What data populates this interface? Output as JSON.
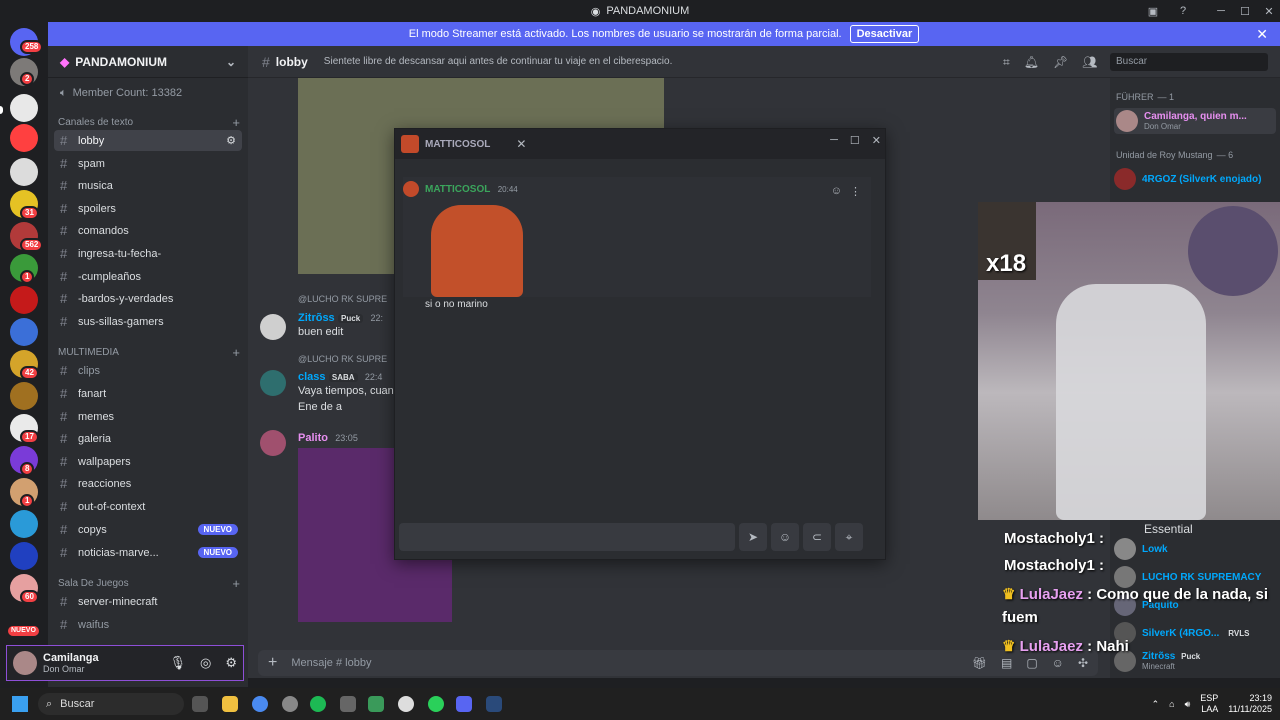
{
  "window": {
    "title": "PANDAMONIUM"
  },
  "banner": {
    "text": "El modo Streamer está activado. Los nombres de usuario se mostrarán de forma parcial.",
    "button": "Desactivar"
  },
  "rail": {
    "badges": [
      "258",
      "2",
      "31",
      "562",
      "1",
      "42",
      "17",
      "8",
      "1",
      "60",
      "NUEVO"
    ]
  },
  "server": {
    "name": "PANDAMONIUM",
    "member_count": "Member Count: 13382"
  },
  "categories": {
    "text": "Canales de texto",
    "media": "MULTIMEDIA",
    "games": "Sala De Juegos"
  },
  "channels": [
    {
      "label": "lobby"
    },
    {
      "label": "spam"
    },
    {
      "label": "musica"
    },
    {
      "label": "spoilers"
    },
    {
      "label": "comandos"
    },
    {
      "label": "ingresa-tu-fecha-"
    },
    {
      "label": "-cumpleaños"
    },
    {
      "label": "-bardos-y-verdades"
    },
    {
      "label": "sus-sillas-gamers"
    },
    {
      "label": "clips"
    },
    {
      "label": "fanart"
    },
    {
      "label": "memes"
    },
    {
      "label": "galeria"
    },
    {
      "label": "wallpapers"
    },
    {
      "label": "reacciones"
    },
    {
      "label": "out-of-context"
    },
    {
      "label": "copys",
      "badge": "NUEVO"
    },
    {
      "label": "noticias-marve...",
      "badge": "NUEVO"
    },
    {
      "label": "server-minecraft"
    },
    {
      "label": "waifus"
    }
  ],
  "user": {
    "name": "Camilanga",
    "status": "Don Omar"
  },
  "chat": {
    "channel": "lobby",
    "topic": "Sientete libre de descansar aqui antes de continuar tu viaje en el ciberespacio.",
    "search_placeholder": "Buscar",
    "composer_placeholder": "Mensaje #",
    "composer_channel": "lobby",
    "messages": [
      {
        "reply": "@LUCHO RK SUPRE",
        "author": "Zitrõss",
        "tag": "Puck",
        "time": "22:",
        "text": "buen edit"
      },
      {
        "reply": "@LUCHO RK SUPRE",
        "author": "class",
        "tag": "SABA",
        "time": "22:4",
        "text": "Vaya tiempos, cuando",
        "text2": "Ene de a"
      },
      {
        "author": "Palito",
        "time": "23:05"
      }
    ]
  },
  "popout": {
    "title": "MATTICOSOL",
    "author": "MATTICOSOL",
    "time": "20:44",
    "text": "si o no marino"
  },
  "members": {
    "role1": "FÜHRER",
    "role1_count": "— 1",
    "m1_name": "Camilanga, quien m...",
    "m1_status": "Don Omar",
    "role2": "Unidad de Roy Mustang",
    "role2_count": "— 6",
    "m2_name": "4RGOZ (SilverK enojado)",
    "m3_status": "Essential",
    "m4_name": "Lowk",
    "m5_name": "LUCHO RK SUPREMACY",
    "m6_name": "Paquito",
    "m7_name": "SilverK (4RGO...",
    "m7_tag": "RVLS",
    "m8_name": "Zitrõss",
    "m8_tag": "Puck",
    "m8_status": "Minecraft"
  },
  "stream": {
    "badge": "x18",
    "lines": [
      {
        "name": "Mostacholy1",
        "text": " :"
      },
      {
        "name": "Mostacholy1",
        "text": " :"
      },
      {
        "name": "LulaJaez",
        "text": " : Como que de la nada, si"
      },
      {
        "name": "",
        "text": "fuem"
      },
      {
        "name": "LulaJaez",
        "text": " : Nahi"
      }
    ]
  },
  "taskbar": {
    "search": "Buscar",
    "lang1": "ESP",
    "lang2": "LAA",
    "time": "23:19",
    "date": "11/11/2025"
  },
  "colors": {
    "blurple": "#5865f2",
    "pink": "#e78ff0",
    "blue": "#00a8fc",
    "red": "#f23f43"
  }
}
